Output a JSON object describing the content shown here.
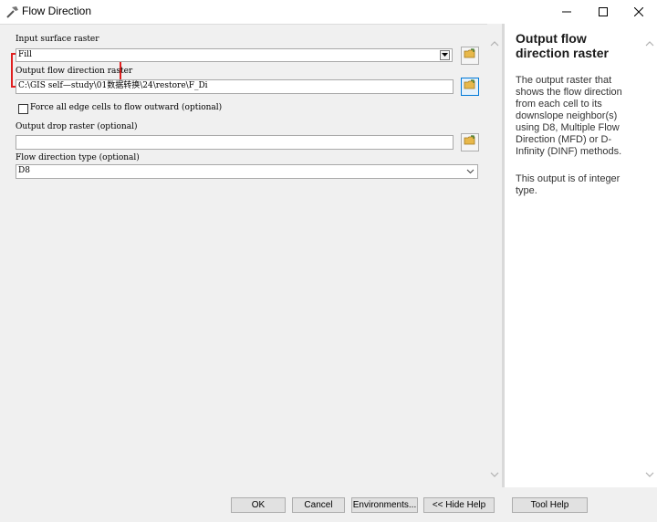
{
  "window": {
    "title": "Flow Direction",
    "icon": "hammer-icon",
    "controls": [
      "minimize-icon",
      "maximize-icon",
      "close-icon"
    ]
  },
  "form": {
    "input_surface": {
      "label": "Input surface raster",
      "value": "Fill"
    },
    "output_flow": {
      "label": "Output flow direction raster",
      "value": "C:\\GIS  self—study\\01数据转换\\24\\restore\\F_Di"
    },
    "force_edge": {
      "label": "Force all edge cells to flow outward (optional)",
      "checked": false
    },
    "output_drop": {
      "label": "Output drop raster (optional)",
      "value": ""
    },
    "flow_type": {
      "label": "Flow direction type (optional)",
      "value": "D8"
    }
  },
  "help": {
    "title": "Output flow direction raster",
    "description": "The output raster that shows the flow direction from each cell to its downslope neighbor(s) using D8, Multiple Flow Direction (MFD) or D-Infinity (DINF) methods.",
    "note": "This output is of integer type."
  },
  "buttons": {
    "ok": "OK",
    "cancel": "Cancel",
    "environments": "Environments...",
    "hide_help": "<< Hide Help",
    "tool_help": "Tool Help"
  },
  "colors": {
    "highlight": "#e02020",
    "accent": "#0078d7",
    "pane_bg": "#f0f0f0"
  }
}
